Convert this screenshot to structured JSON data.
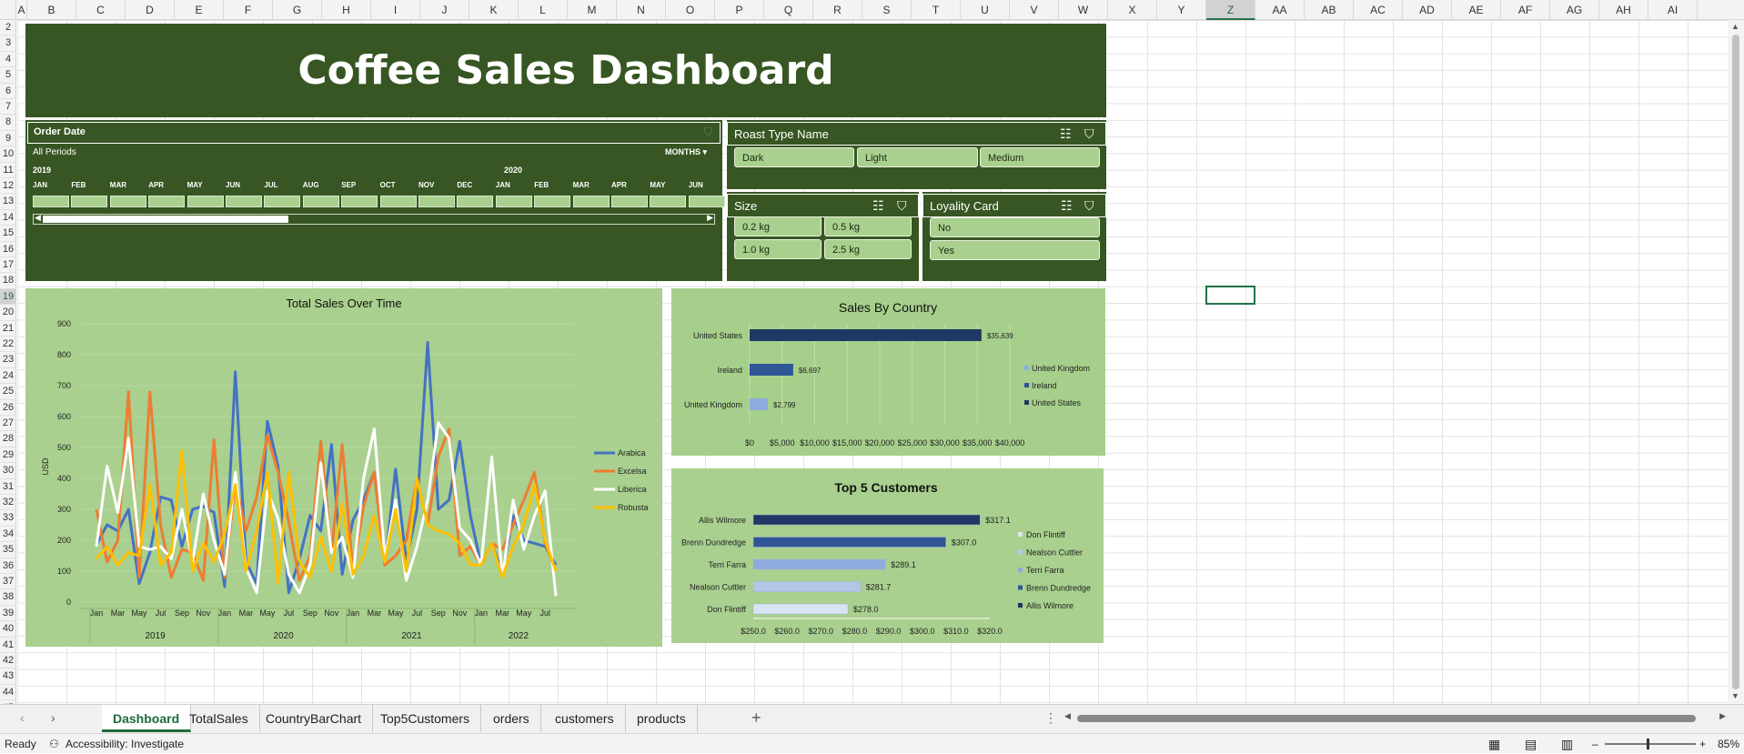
{
  "columns": [
    "A",
    "B",
    "C",
    "D",
    "E",
    "F",
    "G",
    "H",
    "I",
    "J",
    "K",
    "L",
    "M",
    "N",
    "O",
    "P",
    "Q",
    "R",
    "S",
    "T",
    "U",
    "V",
    "W",
    "X",
    "Y",
    "Z",
    "AA",
    "AB",
    "AC",
    "AD",
    "AE",
    "AF",
    "AG",
    "AH",
    "AI"
  ],
  "selected_column": "Z",
  "rows": [
    "2",
    "3",
    "4",
    "5",
    "6",
    "7",
    "8",
    "9",
    "10",
    "11",
    "12",
    "13",
    "14",
    "15",
    "16",
    "17",
    "18",
    "19",
    "20",
    "21",
    "22",
    "23",
    "24",
    "25",
    "26",
    "27",
    "28",
    "29",
    "30",
    "31",
    "32",
    "33",
    "34",
    "35",
    "36",
    "37",
    "38",
    "39",
    "40",
    "41",
    "42",
    "43",
    "44",
    "45"
  ],
  "selected_row": "19",
  "dashboard": {
    "title": "Coffee Sales Dashboard"
  },
  "order_date": {
    "title": "Order Date",
    "period": "All Periods",
    "unit": "MONTHS",
    "year1": "2019",
    "year2": "2020",
    "months": [
      "JAN",
      "FEB",
      "MAR",
      "APR",
      "MAY",
      "JUN",
      "JUL",
      "AUG",
      "SEP",
      "OCT",
      "NOV",
      "DEC",
      "JAN",
      "FEB",
      "MAR",
      "APR",
      "MAY",
      "JUN"
    ]
  },
  "roast": {
    "title": "Roast Type Name",
    "options": [
      "Dark",
      "Light",
      "Medium"
    ]
  },
  "size": {
    "title": "Size",
    "options": [
      "0.2 kg",
      "0.5 kg",
      "1.0 kg",
      "2.5 kg"
    ]
  },
  "loyalty": {
    "title": "Loyality Card",
    "options": [
      "No",
      "Yes"
    ]
  },
  "chart_data": [
    {
      "type": "line",
      "title": "Total Sales Over Time",
      "ylabel": "USD",
      "ylim": [
        0,
        900
      ],
      "yticks": [
        "0",
        "100",
        "200",
        "300",
        "400",
        "500",
        "600",
        "700",
        "800",
        "900"
      ],
      "x": [
        "Jan",
        "Feb",
        "Mar",
        "Apr",
        "May",
        "Jun",
        "Jul",
        "Aug",
        "Sep",
        "Oct",
        "Nov",
        "Dec",
        "Jan",
        "Feb",
        "Mar",
        "Apr",
        "May",
        "Jun",
        "Jul",
        "Aug",
        "Sep",
        "Oct",
        "Nov",
        "Dec",
        "Jan",
        "Feb",
        "Mar",
        "Apr",
        "May",
        "Jun",
        "Jul",
        "Aug",
        "Sep",
        "Oct",
        "Nov",
        "Dec",
        "Jan",
        "Feb",
        "Mar",
        "Apr",
        "May",
        "Jun",
        "Jul",
        "Aug"
      ],
      "x_labels": [
        "Jan",
        "Mar",
        "May",
        "Jul",
        "Sep",
        "Nov",
        "Jan",
        "Mar",
        "May",
        "Jul",
        "Sep",
        "Nov",
        "Jan",
        "Mar",
        "May",
        "Jul",
        "Sep",
        "Nov",
        "Jan",
        "Mar",
        "May",
        "Jul"
      ],
      "years": [
        "2019",
        "2020",
        "2021",
        "2022"
      ],
      "series": [
        {
          "name": "Arabica",
          "color": "#4472c4",
          "values": [
            186,
            250,
            230,
            300,
            60,
            160,
            340,
            330,
            180,
            300,
            310,
            290,
            50,
            745,
            130,
            60,
            585,
            440,
            30,
            140,
            280,
            230,
            510,
            90,
            265,
            330,
            420,
            120,
            430,
            130,
            300,
            840,
            300,
            330,
            520,
            280,
            120,
            190,
            95,
            280,
            200,
            190,
            180,
            120
          ]
        },
        {
          "name": "Excelsa",
          "color": "#ed7d31",
          "values": [
            300,
            130,
            200,
            680,
            80,
            680,
            250,
            80,
            170,
            160,
            70,
            525,
            80,
            390,
            230,
            340,
            540,
            420,
            260,
            70,
            150,
            520,
            160,
            510,
            100,
            310,
            420,
            120,
            150,
            200,
            400,
            250,
            470,
            560,
            150,
            180,
            120,
            190,
            170,
            250,
            330,
            420,
            190,
            100
          ]
        },
        {
          "name": "Liberica",
          "color": "#ffffff",
          "values": [
            180,
            440,
            290,
            530,
            180,
            170,
            180,
            140,
            300,
            130,
            350,
            200,
            90,
            420,
            110,
            30,
            360,
            270,
            90,
            30,
            120,
            450,
            160,
            210,
            80,
            400,
            560,
            140,
            330,
            70,
            180,
            330,
            580,
            530,
            240,
            200,
            120,
            470,
            80,
            330,
            170,
            280,
            360,
            20
          ]
        },
        {
          "name": "Robusta",
          "color": "#ffc000",
          "values": [
            140,
            180,
            120,
            160,
            150,
            380,
            120,
            160,
            490,
            100,
            190,
            130,
            220,
            380,
            100,
            230,
            420,
            60,
            420,
            130,
            80,
            210,
            100,
            320,
            90,
            150,
            280,
            130,
            300,
            100,
            400,
            250,
            230,
            220,
            190,
            120,
            120,
            190,
            80,
            180,
            250,
            380,
            200,
            100
          ]
        }
      ]
    },
    {
      "type": "bar",
      "title": "Sales By Country",
      "categories": [
        "United States",
        "Ireland",
        "United Kingdom"
      ],
      "values": [
        35639,
        6697,
        2799
      ],
      "value_labels": [
        "$35,639",
        "$6,697",
        "$2,799"
      ],
      "xlim": [
        0,
        40000
      ],
      "xticks": [
        "$0",
        "$5,000",
        "$10,000",
        "$15,000",
        "$20,000",
        "$25,000",
        "$30,000",
        "$35,000",
        "$40,000"
      ],
      "colors": [
        "#203864",
        "#2f5597",
        "#8faadc"
      ],
      "legend": [
        "United Kingdom",
        "Ireland",
        "United States"
      ]
    },
    {
      "type": "bar",
      "title": "Top 5 Customers",
      "categories": [
        "Allis Wilmore",
        "Brenn Dundredge",
        "Terri Farra",
        "Nealson Cuttler",
        "Don Flintiff"
      ],
      "values": [
        317.1,
        307.0,
        289.1,
        281.7,
        278.0
      ],
      "value_labels": [
        "$317.1",
        "$307.0",
        "$289.1",
        "$281.7",
        "$278.0"
      ],
      "xlim": [
        250,
        320
      ],
      "xticks": [
        "$250.0",
        "$260.0",
        "$270.0",
        "$280.0",
        "$290.0",
        "$300.0",
        "$310.0",
        "$320.0"
      ],
      "colors": [
        "#203864",
        "#2f5597",
        "#8faadc",
        "#b4c7e7",
        "#dae3f3"
      ],
      "legend": [
        "Don Flintiff",
        "Nealson Cuttler",
        "Terri Farra",
        "Brenn Dundredge",
        "Allis Wilmore"
      ]
    }
  ],
  "tabs": [
    "Dashboard",
    "TotalSales",
    "CountryBarChart",
    "Top5Customers",
    "orders",
    "customers",
    "products"
  ],
  "active_tab": "Dashboard",
  "status": {
    "ready": "Ready",
    "accessibility": "Accessibility: Investigate",
    "zoom": "85%"
  }
}
